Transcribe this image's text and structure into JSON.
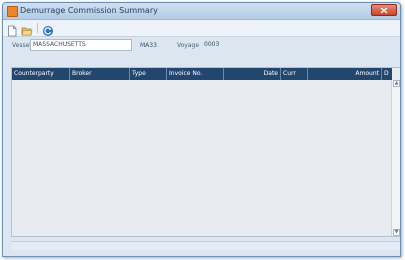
{
  "window": {
    "title": "Demurrage Commission Summary"
  },
  "toolbar": {
    "buttons": [
      {
        "name": "new-icon"
      },
      {
        "name": "open-folder-icon"
      },
      {
        "name": "refresh-icon"
      }
    ]
  },
  "filters": {
    "vessel_label": "Vessel",
    "vessel_value": "MASSACHUSETTS",
    "vessel_code": "MA33",
    "voyage_label": "Voyage",
    "voyage_value": "0003"
  },
  "grid": {
    "columns": [
      "Counterparty",
      "Broker",
      "Type",
      "Invoice No.",
      "Date",
      "Curr",
      "Amount",
      "D"
    ],
    "rows": []
  },
  "colors": {
    "header_bg": "#23466f",
    "window_bg": "#dbe6f1",
    "close_button": "#c7442c"
  }
}
